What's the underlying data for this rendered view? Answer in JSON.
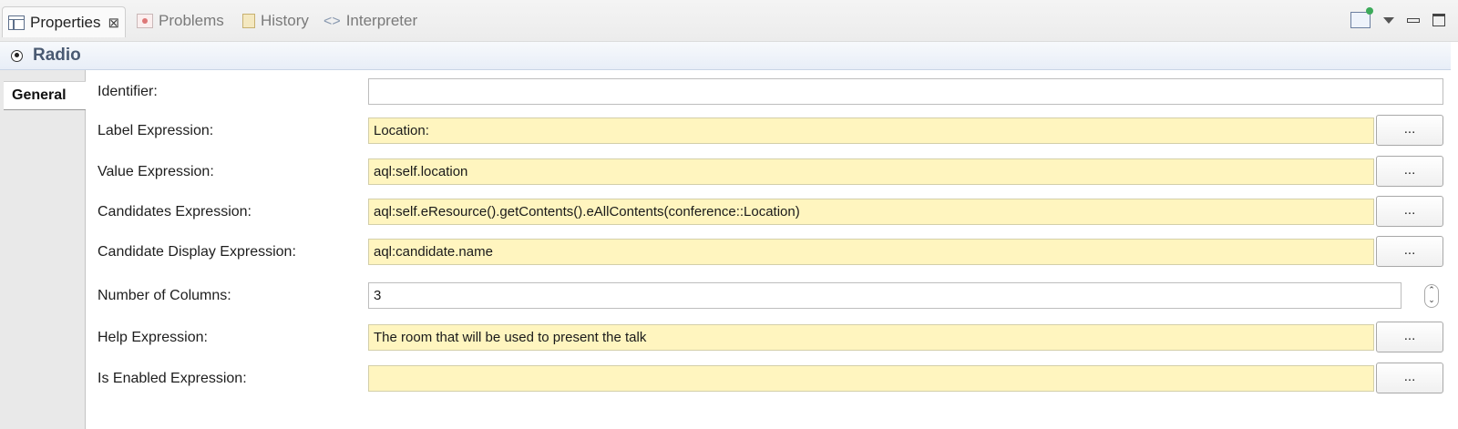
{
  "tabs": {
    "properties": {
      "label": "Properties",
      "close": "⊠"
    },
    "problems": {
      "label": "Problems"
    },
    "history": {
      "label": "History"
    },
    "interpreter": {
      "label": "Interpreter",
      "icon": "<>"
    }
  },
  "view_actions": [
    "pin-icon",
    "view-menu-icon",
    "minimize-icon",
    "maximize-icon"
  ],
  "title": "Radio",
  "side_tab": "General",
  "form": {
    "identifier": {
      "label": "Identifier:",
      "value": ""
    },
    "label_expression": {
      "label": "Label Expression:",
      "value": "Location:",
      "button": "..."
    },
    "value_expression": {
      "label": "Value Expression:",
      "value": "aql:self.location",
      "button": "..."
    },
    "candidates_expression": {
      "label": "Candidates Expression:",
      "value": "aql:self.eResource().getContents().eAllContents(conference::Location)",
      "button": "..."
    },
    "candidate_display_expression": {
      "label": "Candidate Display Expression:",
      "value": "aql:candidate.name",
      "button": "..."
    },
    "number_of_columns": {
      "label": "Number of Columns:",
      "value": "3",
      "spinner_up": "⌃",
      "spinner_down": "⌄"
    },
    "help_expression": {
      "label": "Help Expression:",
      "value": "The room that will be used to present the talk",
      "button": "..."
    },
    "is_enabled_expression": {
      "label": "Is Enabled Expression:",
      "value": "",
      "button": "..."
    }
  },
  "colors": {
    "expression_field": "#fff5bf",
    "title_text": "#4a5a72"
  }
}
